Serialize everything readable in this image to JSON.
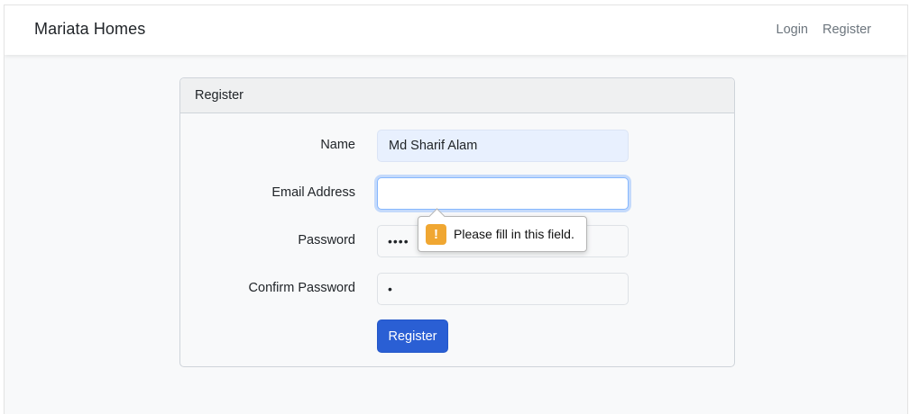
{
  "navbar": {
    "brand": "Mariata Homes",
    "links": [
      {
        "label": "Login"
      },
      {
        "label": "Register"
      }
    ]
  },
  "card": {
    "header": "Register",
    "fields": {
      "name": {
        "label": "Name",
        "value": "Md Sharif Alam"
      },
      "email": {
        "label": "Email Address",
        "value": ""
      },
      "password": {
        "label": "Password",
        "mask": "••••"
      },
      "confirm": {
        "label": "Confirm Password",
        "mask": "•"
      }
    },
    "submit_label": "Register"
  },
  "validation": {
    "message": "Please fill in this field.",
    "icon": "exclamation-icon",
    "icon_glyph": "!",
    "icon_color": "#f0a732"
  },
  "colors": {
    "primary": "#2a5fd4",
    "autofill": "#e8f0fe",
    "focus_ring": "#86b7fe"
  }
}
